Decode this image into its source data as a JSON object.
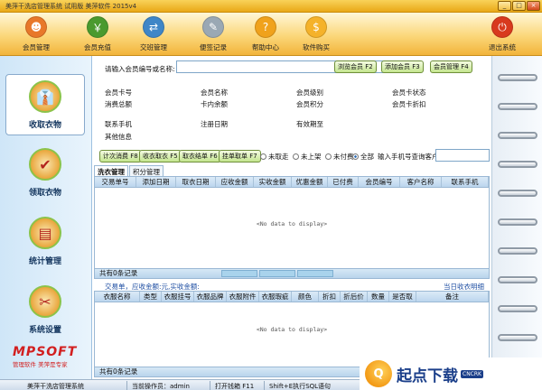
{
  "window": {
    "title": "美萍干洗店管理系统 试用版 美萍软件  2015v4",
    "controls": [
      "_",
      "□",
      "×"
    ]
  },
  "toolbar": [
    {
      "label": "会员管理",
      "icon": "member-icon",
      "color": "#e8782a",
      "glyph": "☻"
    },
    {
      "label": "会员充值",
      "icon": "recharge-icon",
      "color": "#4a9a2e",
      "glyph": "￥"
    },
    {
      "label": "交班管理",
      "icon": "shift-icon",
      "color": "#3f86c7",
      "glyph": "⇄"
    },
    {
      "label": "便签记录",
      "icon": "notes-icon",
      "color": "#9aa8b4",
      "glyph": "✎"
    },
    {
      "label": "帮助中心",
      "icon": "help-icon",
      "color": "#f0a21c",
      "glyph": "?"
    },
    {
      "label": "软件购买",
      "icon": "purchase-icon",
      "color": "#f5b22a",
      "glyph": "$"
    },
    {
      "label": "退出系统",
      "icon": "exit-icon",
      "color": "#d83a1e",
      "glyph": "⏻"
    }
  ],
  "sidebar": [
    {
      "label": "收取衣物",
      "icon": "clothes-receive-icon",
      "glyph": "👔",
      "active": true
    },
    {
      "label": "领取衣物",
      "icon": "clothes-pickup-icon",
      "glyph": "✔",
      "active": false
    },
    {
      "label": "统计管理",
      "icon": "statistics-icon",
      "glyph": "▤",
      "active": false
    },
    {
      "label": "系统设置",
      "icon": "settings-icon",
      "glyph": "✂",
      "active": false
    }
  ],
  "logo": {
    "text": "MPSOFT",
    "slogan": "管理软件  美萍是专家"
  },
  "search": {
    "label": "请输入会员编号或名称:",
    "value": "",
    "buttons": [
      "浏览会员 F2",
      "添加会员 F3",
      "会员管理 F4"
    ]
  },
  "member_info": {
    "row1": [
      "会员卡号",
      "会员名称",
      "会员级别",
      "会员卡状态"
    ],
    "row2": [
      "消费总额",
      "卡内余额",
      "会员积分",
      "会员卡折扣"
    ],
    "row3": [
      "联系手机",
      "注册日期",
      "有效期至"
    ],
    "row4": [
      "其他信息"
    ]
  },
  "filter": {
    "buttons": [
      "计次消费 F8",
      "收衣取衣 F5",
      "取衣结单 F6",
      "挂单取单 F7"
    ],
    "radios": [
      {
        "label": "未取走",
        "checked": false
      },
      {
        "label": "未上架",
        "checked": false
      },
      {
        "label": "未付费",
        "checked": false
      },
      {
        "label": "全部",
        "checked": true
      }
    ],
    "phone_label": "输入手机号查询客户",
    "phone_value": ""
  },
  "tabs": [
    {
      "label": "洗衣管理",
      "active": true
    },
    {
      "label": "积分管理",
      "active": false
    }
  ],
  "orders_table": {
    "columns": [
      "交易单号",
      "添加日期",
      "取衣日期",
      "应收金额",
      "实收金额",
      "优惠金额",
      "已付费",
      "会员编号",
      "客户名称",
      "联系手机"
    ],
    "empty_text": "<No data to display>",
    "footer": "共有0条记录"
  },
  "summary": {
    "text": "交易单，应收金额:元,实收金额:",
    "link": "当日收衣明细"
  },
  "items_table": {
    "columns": [
      "衣服名称",
      "类型",
      "衣服挂号",
      "衣服品牌",
      "衣服附件",
      "衣服瑕疵",
      "颜色",
      "折扣",
      "折后价",
      "数量",
      "是否取",
      "备注"
    ],
    "empty_text": "<No data to display>",
    "footer": "共有0条记录"
  },
  "statusbar": {
    "app": "美萍干洗店管理系统",
    "operator": "当前操作员：admin",
    "drawer": "打开钱箱 F11",
    "sql": "Shift+E执行SQL语句"
  },
  "watermark": {
    "text": "起点下载",
    "sub": "CNCRK"
  }
}
